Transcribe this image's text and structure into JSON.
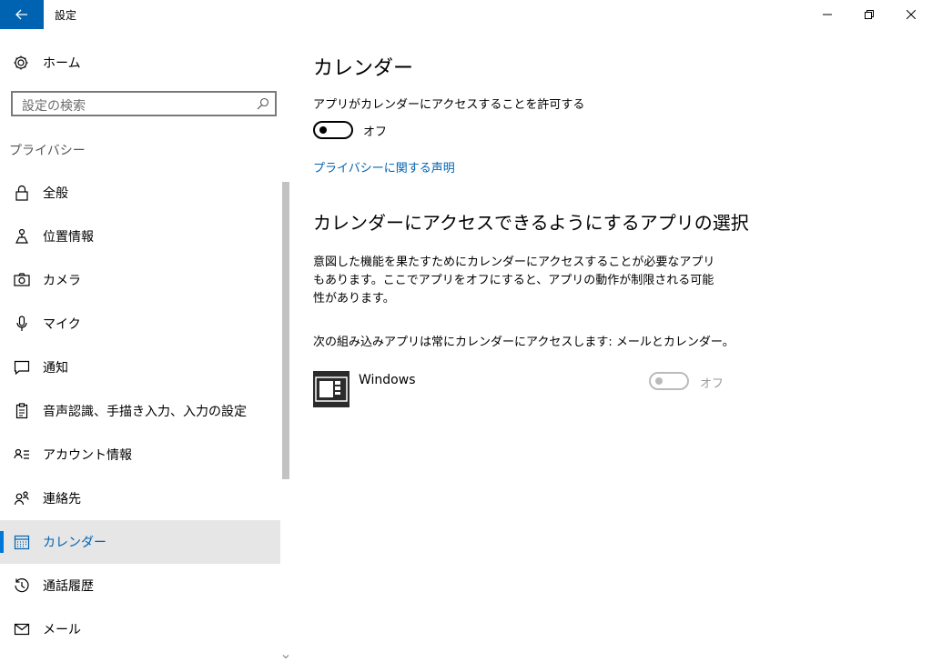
{
  "window": {
    "title": "設定"
  },
  "sidebar": {
    "home_label": "ホーム",
    "search_placeholder": "設定の検索",
    "section_header": "プライバシー",
    "items": [
      {
        "label": "全般",
        "icon": "lock-icon"
      },
      {
        "label": "位置情報",
        "icon": "location-icon"
      },
      {
        "label": "カメラ",
        "icon": "camera-icon"
      },
      {
        "label": "マイク",
        "icon": "microphone-icon"
      },
      {
        "label": "通知",
        "icon": "notification-icon"
      },
      {
        "label": "音声認識、手描き入力、入力の設定",
        "icon": "clipboard-icon"
      },
      {
        "label": "アカウント情報",
        "icon": "account-info-icon"
      },
      {
        "label": "連絡先",
        "icon": "contacts-icon"
      },
      {
        "label": "カレンダー",
        "icon": "calendar-icon",
        "selected": true
      },
      {
        "label": "通話履歴",
        "icon": "history-icon"
      },
      {
        "label": "メール",
        "icon": "mail-icon"
      }
    ]
  },
  "content": {
    "page_title": "カレンダー",
    "allow_label": "アプリがカレンダーにアクセスすることを許可する",
    "allow_toggle_state": "オフ",
    "privacy_link": "プライバシーに関する声明",
    "section_title": "カレンダーにアクセスできるようにするアプリの選択",
    "description": "意図した機能を果たすためにカレンダーにアクセスすることが必要なアプリもあります。ここでアプリをオフにすると、アプリの動作が制限される可能性があります。",
    "builtin_note": "次の組み込みアプリは常にカレンダーにアクセスします: メールとカレンダー。",
    "apps": [
      {
        "name": "Windows",
        "toggle_state": "オフ"
      }
    ]
  },
  "colors": {
    "accent": "#0078d7",
    "back_button": "#0063b1",
    "link": "#0063b1",
    "selected_bg": "#e6e6e6"
  }
}
